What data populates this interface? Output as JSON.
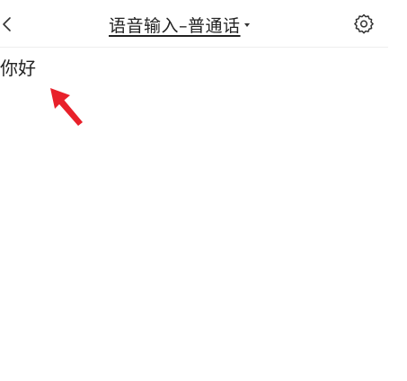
{
  "header": {
    "title": "语音输入–普通话",
    "back_icon": "chevron-left-icon",
    "settings_icon": "gear-icon",
    "dropdown_icon": "caret-down-icon"
  },
  "content": {
    "recognized_text": "你好"
  },
  "annotation": {
    "arrow_color": "#e8202a"
  },
  "colors": {
    "text": "#222222",
    "divider": "#eeeeee",
    "background": "#ffffff"
  }
}
